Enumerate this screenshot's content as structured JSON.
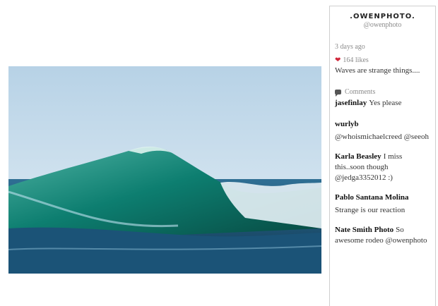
{
  "profile": {
    "username": ".OWENPHOTO.",
    "handle": "@owenphoto"
  },
  "post": {
    "time": "3 days ago",
    "likes": "164 likes",
    "caption": "Waves are strange things....",
    "comments_label": "Comments"
  },
  "comments": [
    {
      "author": "jasefinlay",
      "text": "Yes please"
    },
    {
      "author": "wurlyb",
      "text": "@whoismichaelcreed @seeoh"
    },
    {
      "author": "Karla Beasley",
      "text": "I miss this..soon though @jedga3352012 :)"
    },
    {
      "author": "Pablo Santana Molina",
      "text": "Strange is our reaction"
    },
    {
      "author": "Nate Smith Photo",
      "text": "So awesome rodeo @owenphoto"
    }
  ],
  "icons": {
    "heart": "heart-icon",
    "comments": "comment-bubble-icon"
  },
  "colors": {
    "heart": "#d0263a",
    "muted_text": "#8a8a8a",
    "sky": "#d5e6f1",
    "wave": "#0f7a6e"
  }
}
